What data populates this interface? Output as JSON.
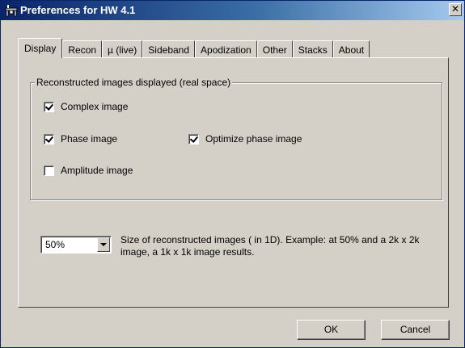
{
  "window": {
    "title": "Preferences for HW 4.1",
    "close_glyph": "✕"
  },
  "tabs": [
    {
      "label": "Display",
      "active": true
    },
    {
      "label": "Recon",
      "active": false
    },
    {
      "label": "µ (live)",
      "active": false
    },
    {
      "label": "Sideband",
      "active": false
    },
    {
      "label": "Apodization",
      "active": false
    },
    {
      "label": "Other",
      "active": false
    },
    {
      "label": "Stacks",
      "active": false
    },
    {
      "label": "About",
      "active": false
    }
  ],
  "display_tab": {
    "group_title": "Reconstructed images displayed (real space)",
    "checkboxes": {
      "complex": {
        "label": "Complex image",
        "checked": true
      },
      "phase": {
        "label": "Phase image",
        "checked": true
      },
      "optimize_phase": {
        "label": "Optimize phase image",
        "checked": true
      },
      "amplitude": {
        "label": "Amplitude image",
        "checked": false
      }
    },
    "size_select": {
      "value": "50%"
    },
    "size_description": "Size of reconstructed images  ( in 1D). Example: at 50% and a 2k x 2k image, a 1k x 1k image results."
  },
  "buttons": {
    "ok": "OK",
    "cancel": "Cancel"
  },
  "icons": {
    "title_icon": "app-icon",
    "dropdown_icon": "chevron-down-icon"
  },
  "colors": {
    "titlebar_start": "#0a246a",
    "titlebar_end": "#a6caf0",
    "dialog_bg": "#d4d0c8"
  }
}
